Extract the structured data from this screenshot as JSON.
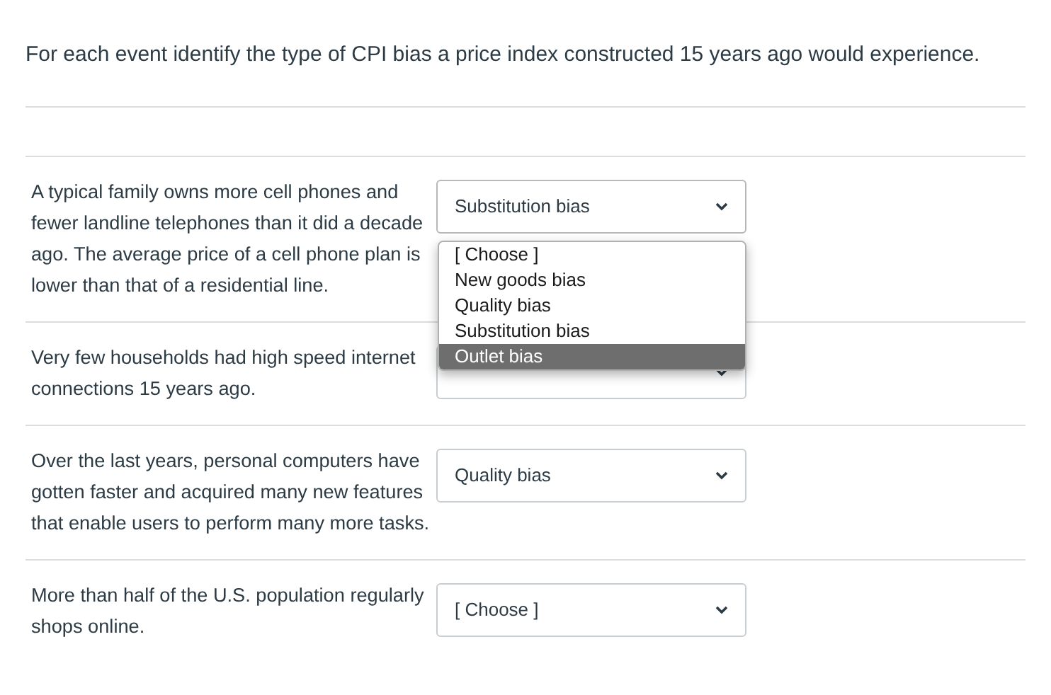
{
  "instruction": "For each event identify the type of CPI bias a price index constructed 15 years ago would experience.",
  "rows": [
    {
      "text": "A typical family owns more cell phones and fewer landline telephones than it did a decade ago. The average price of a cell phone plan is lower than that of a residential line.",
      "answer": "Substitution bias",
      "expanded": true,
      "options": [
        {
          "label": "[ Choose ]",
          "highlighted": false
        },
        {
          "label": "New goods bias",
          "highlighted": false
        },
        {
          "label": "Quality bias",
          "highlighted": false
        },
        {
          "label": "Substitution bias",
          "highlighted": false
        },
        {
          "label": "Outlet bias",
          "highlighted": true
        }
      ]
    },
    {
      "text": "Very few households had high speed internet connections 15 years ago.",
      "expanded": false
    },
    {
      "text": "Over the last years, personal computers have gotten faster and acquired many new features that enable users to perform many more tasks.",
      "answer": "Quality bias",
      "expanded": false
    },
    {
      "text": "More than half of the U.S. population regularly shops online.",
      "answer": "[ Choose ]",
      "expanded": false
    }
  ]
}
